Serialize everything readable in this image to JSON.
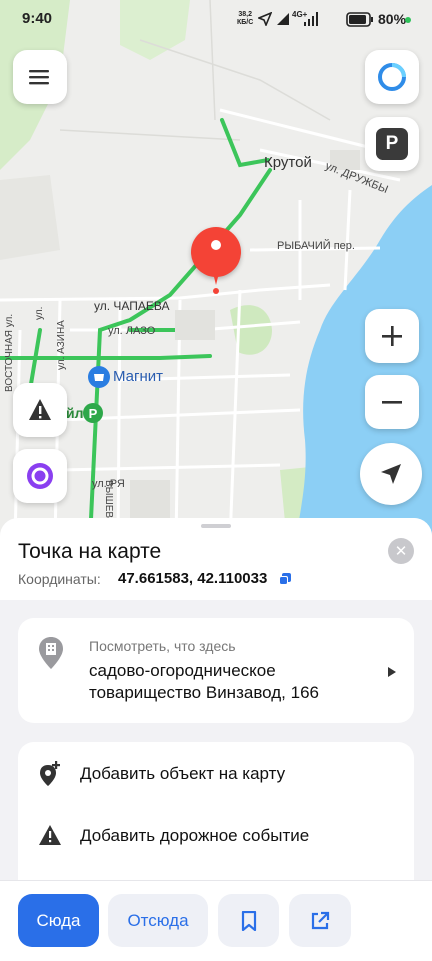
{
  "status_bar": {
    "time": "9:40",
    "net_speed_value": "38,2",
    "net_speed_unit": "КБ/С",
    "network": "4G+",
    "battery": "80%"
  },
  "map": {
    "labels": {
      "krutoy": "Крутой",
      "druzhby": "ул. ДРУЖБЫ",
      "rybachiy": "РЫБАЧИЙ пер.",
      "chapaeva": "ул. ЧАПАЕВА",
      "lazo": "ул. ЛАЗО",
      "magnit": "Магнит",
      "vostochnaya": "ВОСТОЧНАЯ ул.",
      "azina": "ул. АЗИНА",
      "vysheva": "ВЫШЕВА",
      "rya": "ул. РЯ",
      "yl": "ул.",
      "yi": "йл"
    },
    "accent_blue": "#2a6fe8",
    "water_color": "#8ccff5",
    "road_green": "#3cc55a",
    "pin_color": "#f44336"
  },
  "sheet": {
    "title": "Точка на карте",
    "coords_label": "Координаты:",
    "coords_value": "47.661583, 42.110033",
    "whathere_label": "Посмотреть, что здесь",
    "place_name": "садово-огородническое товарищество Винзавод, 166",
    "action_add_object": "Добавить объект на карту",
    "action_add_road_event": "Добавить дорожное событие"
  },
  "bottom_bar": {
    "to_here": "Сюда",
    "from_here": "Отсюда"
  }
}
